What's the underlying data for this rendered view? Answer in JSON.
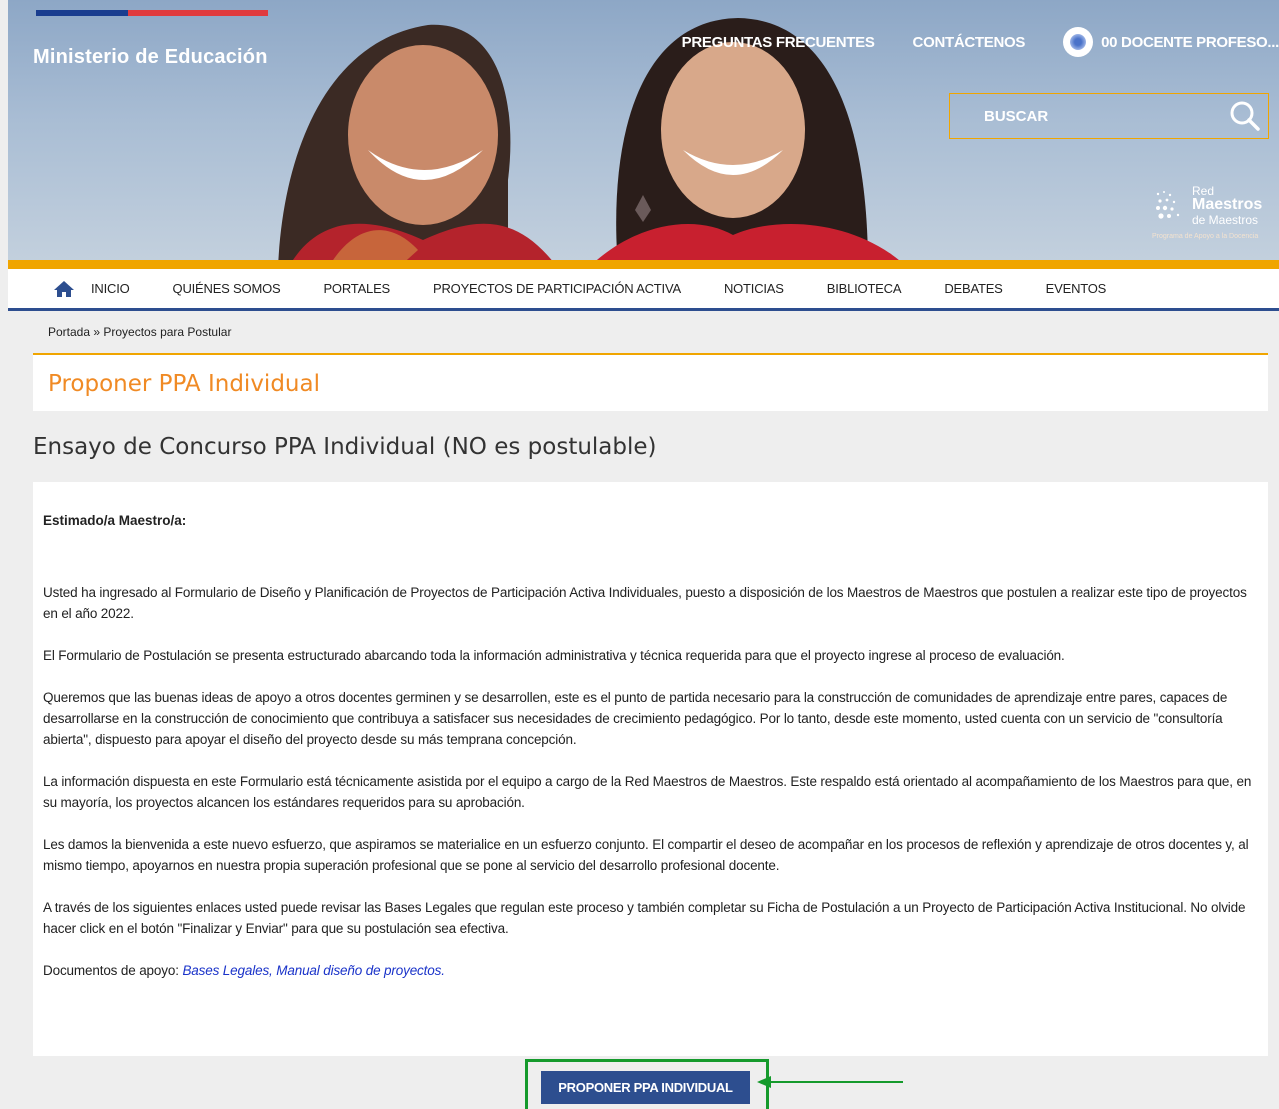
{
  "header": {
    "brand": "Ministerio de Educación",
    "top_links": {
      "faq": "PREGUNTAS FRECUENTES",
      "contact": "CONTÁCTENOS",
      "user": "00 DOCENTE PROFESO..."
    },
    "search": {
      "placeholder": "BUSCAR"
    },
    "logo": {
      "line1": "Red",
      "line2": "Maestros",
      "line3": "de Maestros",
      "tagline": "Programa de Apoyo a la Docencia"
    }
  },
  "nav": {
    "items": [
      "INICIO",
      "QUIÉNES SOMOS",
      "PORTALES",
      "PROYECTOS DE PARTICIPACIÓN ACTIVA",
      "NOTICIAS",
      "BIBLIOTECA",
      "DEBATES",
      "EVENTOS"
    ]
  },
  "breadcrumb": {
    "home": "Portada",
    "sep": " » ",
    "current": "Proyectos para Postular"
  },
  "page": {
    "title": "Proponer PPA Individual",
    "subtitle": "Ensayo de Concurso PPA Individual (NO es postulable)",
    "greeting": "Estimado/a Maestro/a:",
    "paragraphs": [
      "Usted ha ingresado al Formulario de Diseño y Planificación de Proyectos de Participación Activa Individuales, puesto a disposición de los Maestros de Maestros que postulen a realizar este tipo de proyectos en el año 2022.",
      "El Formulario de Postulación se presenta estructurado abarcando toda la información administrativa y técnica requerida para que el proyecto ingrese al proceso de evaluación.",
      "Queremos que las buenas ideas de apoyo a otros docentes germinen y se desarrollen, este es el punto de partida necesario para la construcción de comunidades de aprendizaje entre pares, capaces de desarrollarse en la construcción de conocimiento que contribuya a satisfacer sus necesidades de crecimiento pedagógico. Por lo tanto, desde este momento, usted cuenta con un servicio de \"consultoría abierta\", dispuesto para apoyar el diseño del proyecto desde su más temprana concepción.",
      "La información dispuesta en este Formulario está técnicamente asistida por el equipo a cargo de la Red Maestros de Maestros. Este respaldo está orientado al acompañamiento de los Maestros para que, en su mayoría, los proyectos alcancen los estándares requeridos para su aprobación.",
      "Les damos la bienvenida a este nuevo esfuerzo, que aspiramos se materialice en un esfuerzo conjunto. El compartir el deseo de acompañar en los procesos de reflexión y aprendizaje de otros docentes y, al mismo tiempo, apoyarnos en nuestra propia superación profesional que se pone al servicio del desarrollo profesional docente.",
      "A través de los siguientes enlaces usted puede revisar las Bases Legales que regulan este proceso y también completar su Ficha de Postulación a un Proyecto de Participación Activa Institucional. No olvide hacer click en el botón \"Finalizar y Enviar\" para que su postulación sea efectiva."
    ],
    "docs_label": "Documentos de apoyo: ",
    "doc_link_1": "Bases Legales,",
    "doc_link_2": "Manual diseño de proyectos.",
    "cta_label": "PROPONER PPA INDIVIDUAL"
  },
  "colors": {
    "accent_orange": "#f0a500",
    "title_orange": "#f08a24",
    "nav_blue": "#2d4e8f",
    "link_blue": "#1a33c9",
    "highlight_green": "#159a2c"
  }
}
